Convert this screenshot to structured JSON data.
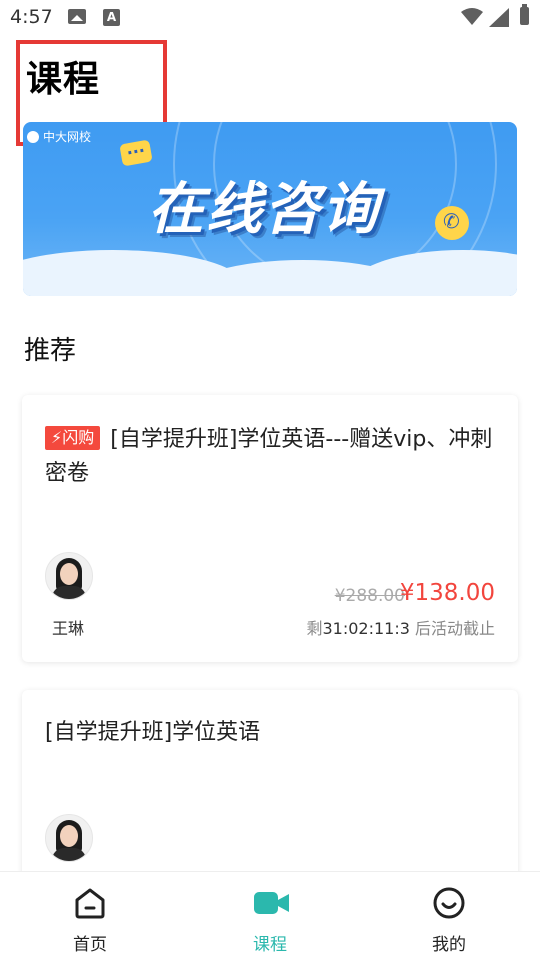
{
  "status_bar": {
    "time": "4:57"
  },
  "page_title": "课程",
  "banner": {
    "logo_text": "中大网校",
    "headline": "在线咨询"
  },
  "section_title": "推荐",
  "courses": [
    {
      "badge": "⚡闪购",
      "title": "[自学提升班]学位英语---赠送vip、冲刺密卷",
      "teacher": "王琳",
      "original_price": "¥288.00",
      "price": "¥138.00",
      "countdown_prefix": "剩",
      "countdown": "31:02:11:3",
      "countdown_suffix": " 后活动截止"
    },
    {
      "title": "[自学提升班]学位英语"
    }
  ],
  "bottom_nav": [
    {
      "label": "首页",
      "icon": "home-icon",
      "active": false
    },
    {
      "label": "课程",
      "icon": "video-camera-icon",
      "active": true
    },
    {
      "label": "我的",
      "icon": "smiley-profile-icon",
      "active": false
    }
  ],
  "colors": {
    "accent": "#2bb8ad",
    "price": "#f2453d",
    "badge": "#f4493d",
    "highlight": "#e53935",
    "banner": "#3f9bf2"
  }
}
